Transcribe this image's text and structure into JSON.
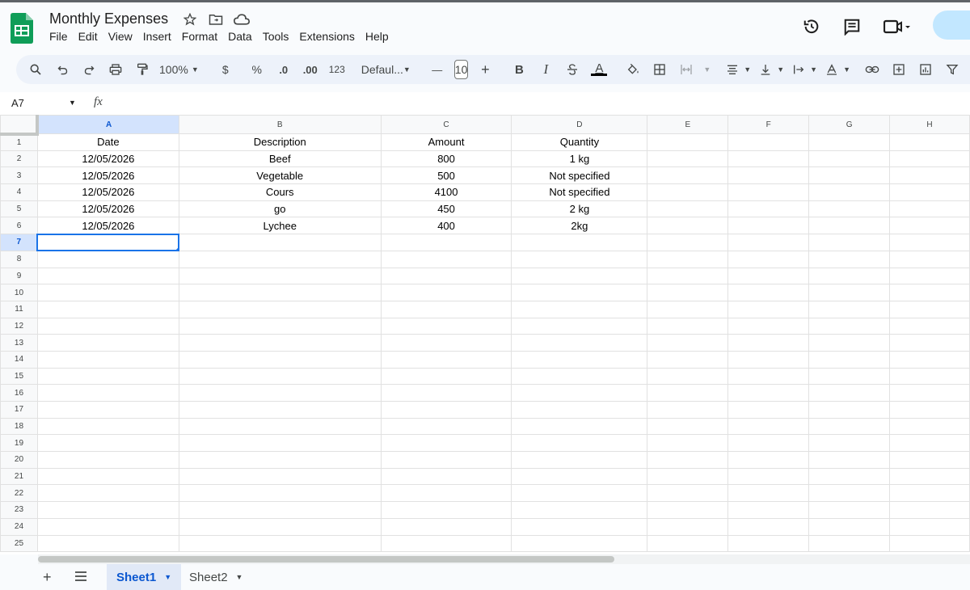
{
  "app": {
    "doc_title": "Monthly Expenses",
    "menu": [
      "File",
      "Edit",
      "View",
      "Insert",
      "Format",
      "Data",
      "Tools",
      "Extensions",
      "Help"
    ],
    "brand_color": "#0f9d58",
    "accent_color": "#1a73e8"
  },
  "toolbar": {
    "zoom": "100%",
    "currency": "$",
    "percent": "%",
    "decrease_decimal": ".0",
    "increase_decimal": ".00",
    "number_format": "123",
    "font_name": "Defaul...",
    "font_size": "10",
    "minus": "—",
    "plus": "+",
    "bold": "B",
    "italic": "I",
    "text_color": "A"
  },
  "formula_bar": {
    "name_box": "A7",
    "fx": "fx",
    "content": ""
  },
  "grid": {
    "columns": [
      "A",
      "B",
      "C",
      "D",
      "E",
      "F",
      "G",
      "H"
    ],
    "selected_cell": "A7",
    "rows": [
      [
        "Date",
        "Description",
        "Amount",
        "Quantity",
        "",
        "",
        "",
        ""
      ],
      [
        "12/05/2026",
        "Beef",
        "800",
        "1 kg",
        "",
        "",
        "",
        ""
      ],
      [
        "12/05/2026",
        "Vegetable",
        "500",
        "Not specified",
        "",
        "",
        "",
        ""
      ],
      [
        "12/05/2026",
        "Cours",
        "4100",
        "Not specified",
        "",
        "",
        "",
        ""
      ],
      [
        "12/05/2026",
        "go",
        "450",
        "2 kg",
        "",
        "",
        "",
        ""
      ],
      [
        "12/05/2026",
        "Lychee",
        "400",
        "2kg",
        "",
        "",
        "",
        ""
      ],
      [
        "",
        "",
        "",
        "",
        "",
        "",
        "",
        ""
      ],
      [
        "",
        "",
        "",
        "",
        "",
        "",
        "",
        ""
      ],
      [
        "",
        "",
        "",
        "",
        "",
        "",
        "",
        ""
      ],
      [
        "",
        "",
        "",
        "",
        "",
        "",
        "",
        ""
      ],
      [
        "",
        "",
        "",
        "",
        "",
        "",
        "",
        ""
      ],
      [
        "",
        "",
        "",
        "",
        "",
        "",
        "",
        ""
      ],
      [
        "",
        "",
        "",
        "",
        "",
        "",
        "",
        ""
      ],
      [
        "",
        "",
        "",
        "",
        "",
        "",
        "",
        ""
      ],
      [
        "",
        "",
        "",
        "",
        "",
        "",
        "",
        ""
      ],
      [
        "",
        "",
        "",
        "",
        "",
        "",
        "",
        ""
      ],
      [
        "",
        "",
        "",
        "",
        "",
        "",
        "",
        ""
      ],
      [
        "",
        "",
        "",
        "",
        "",
        "",
        "",
        ""
      ],
      [
        "",
        "",
        "",
        "",
        "",
        "",
        "",
        ""
      ],
      [
        "",
        "",
        "",
        "",
        "",
        "",
        "",
        ""
      ],
      [
        "",
        "",
        "",
        "",
        "",
        "",
        "",
        ""
      ],
      [
        "",
        "",
        "",
        "",
        "",
        "",
        "",
        ""
      ],
      [
        "",
        "",
        "",
        "",
        "",
        "",
        "",
        ""
      ],
      [
        "",
        "",
        "",
        "",
        "",
        "",
        "",
        ""
      ],
      [
        "",
        "",
        "",
        "",
        "",
        "",
        "",
        ""
      ]
    ]
  },
  "sheets": {
    "add": "+",
    "tabs": [
      "Sheet1",
      "Sheet2"
    ],
    "active": "Sheet1"
  }
}
